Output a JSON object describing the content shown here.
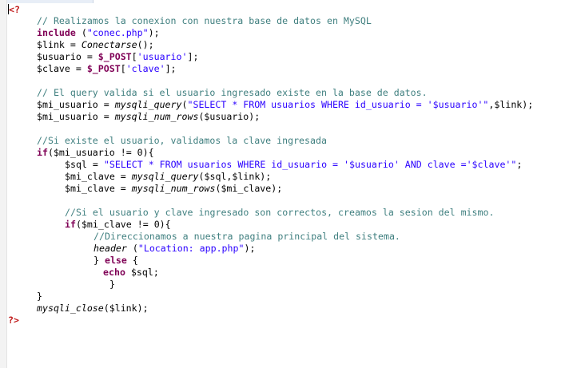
{
  "editor": {
    "open_tag": "<?",
    "close_tag": "?>",
    "lines": {
      "comment_db": "// Realizamos la conexion con nuestra base de datos en MySQL",
      "include_kw": "include",
      "include_rest_a": " (",
      "include_str": "\"conec.php\"",
      "include_rest_b": ");",
      "link_var": "$link = ",
      "link_fn": "Conectarse",
      "link_end": "();",
      "usuario_var": "$usuario = ",
      "usuario_post": "$_POST",
      "usuario_open": "[",
      "usuario_str": "'usuario'",
      "usuario_close": "];",
      "clave_var": "$clave = ",
      "clave_post": "$_POST",
      "clave_open": "[",
      "clave_str": "'clave'",
      "clave_close": "];",
      "comment_query": "// El query valida si el usuario ingresado existe en la base de datos.",
      "q1_var": "$mi_usuario = ",
      "q1_fn": "mysqli_query",
      "q1_open": "(",
      "q1_str": "\"SELECT * FROM usuarios WHERE id_usuario = '$usuario'\"",
      "q1_end": ",$link);",
      "q2_var": "$mi_usuario = ",
      "q2_fn": "mysqli_num_rows",
      "q2_end": "($usuario);",
      "comment_exists": "//Si existe el usuario, validamos la clave ingresada",
      "if1_kw": "if",
      "if1_rest": "($mi_usuario != 0){",
      "sql_var": "$sql = ",
      "sql_str": "\"SELECT * FROM usuarios WHERE id_usuario = '$usuario' AND clave ='$clave'\"",
      "sql_end": ";",
      "c1_var": "$mi_clave = ",
      "c1_fn": "mysqli_query",
      "c1_end": "($sql,$link);",
      "c2_var": "$mi_clave = ",
      "c2_fn": "mysqli_num_rows",
      "c2_end": "($mi_clave);",
      "comment_correct": "//Si el usuario y clave ingresado son correctos, creamos la sesion del mismo.",
      "if2_kw": "if",
      "if2_rest": "($mi_clave != 0){",
      "comment_redirect": "//Direccionamos a nuestra pagina principal del sistema.",
      "header_fn": "header",
      "header_open": " (",
      "header_str": "\"Location: app.php\"",
      "header_end": ");",
      "else_a": "} ",
      "else_kw": "else",
      "else_b": " {",
      "echo_kw": "echo",
      "echo_rest": " $sql;",
      "brace_inner": "}",
      "brace_outer": "}",
      "close_fn": "mysqli_close",
      "close_end": "($link);"
    }
  }
}
